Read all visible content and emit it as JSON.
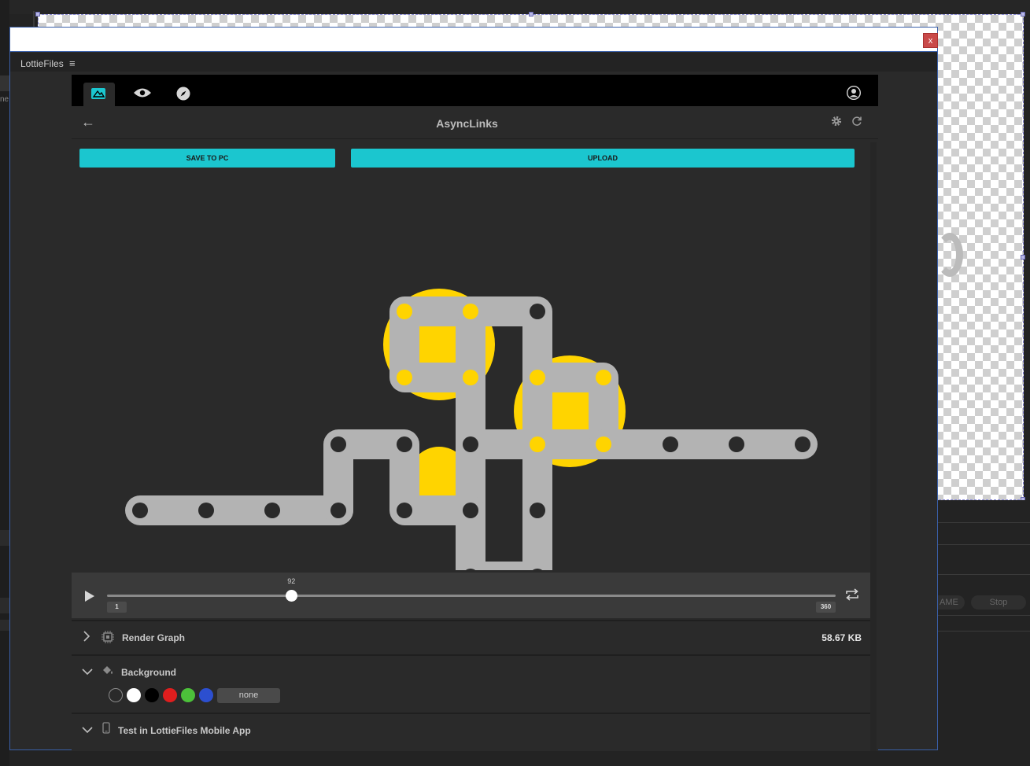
{
  "host": {
    "left_label": "ne",
    "right_field_1": "AME",
    "right_field_2": "Stop"
  },
  "panel": {
    "tab_label": "LottieFiles",
    "menu_glyph": "≡",
    "close_glyph": "x"
  },
  "app": {
    "title": "AsyncLinks",
    "back_glyph": "←",
    "buttons": {
      "save": "SAVE TO PC",
      "upload": "UPLOAD"
    },
    "player": {
      "current_frame": "92",
      "start_frame": "1",
      "end_frame": "360",
      "progress": 0.253
    },
    "sections": {
      "render_graph": {
        "title": "Render Graph",
        "size": "58.67 KB"
      },
      "background": {
        "title": "Background",
        "swatches": [
          "transparent",
          "#ffffff",
          "#000000",
          "#e01e1e",
          "#4cc13a",
          "#2c4fd0"
        ],
        "none_label": "none"
      },
      "mobile": {
        "title": "Test in LottieFiles Mobile App"
      }
    }
  },
  "colors": {
    "accent": "#1bc6cf",
    "link_gray": "#b3b3b3",
    "dot_yellow": "#ffd400"
  }
}
